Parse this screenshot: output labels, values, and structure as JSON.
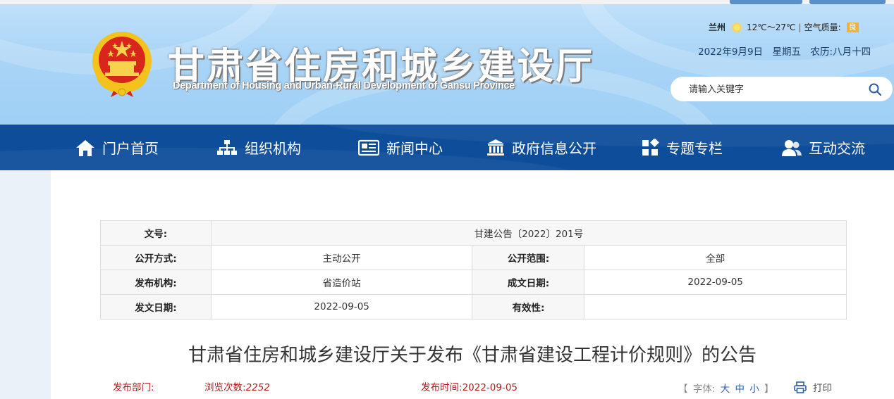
{
  "header": {
    "title": "甘肃省住房和城乡建设厅",
    "subtitle": "Department of Housing and Urban-Rural Development of Gansu Province",
    "weather": {
      "city": "兰州",
      "temp": "12℃～27℃",
      "sep": "|",
      "aqi_label": "空气质量:",
      "aqi_value": "良"
    },
    "date": "2022年9月9日　星期五　农历:八月十四",
    "search_placeholder": "请输入关键字"
  },
  "nav": [
    {
      "label": "门户首页",
      "icon": "home-icon"
    },
    {
      "label": "组织机构",
      "icon": "org-chart-icon"
    },
    {
      "label": "新闻中心",
      "icon": "newspaper-icon"
    },
    {
      "label": "政府信息公开",
      "icon": "government-building-icon"
    },
    {
      "label": "专题专栏",
      "icon": "grid-icon"
    },
    {
      "label": "互动交流",
      "icon": "users-icon"
    }
  ],
  "meta": {
    "doc_no_label": "文号:",
    "doc_no": "甘建公告〔2022〕201号",
    "open_mode_label": "公开方式:",
    "open_mode": "主动公开",
    "open_scope_label": "公开范围:",
    "open_scope": "全部",
    "issuer_label": "发布机构:",
    "issuer": "省造价站",
    "created_label": "成文日期:",
    "created": "2022-09-05",
    "issued_label": "发文日期:",
    "issued": "2022-09-05",
    "validity_label": "有效性:",
    "validity": ""
  },
  "article": {
    "title": "甘肃省住房和城乡建设厅关于发布《甘肃省建设工程计价规则》的公告",
    "dept_label": "发布部门:",
    "views_label": "浏览次数:",
    "views": "2252",
    "time_label": "发布时间:",
    "time": "2022-09-05",
    "font_prefix": "【 字体:",
    "font_large": "大",
    "font_medium": "中",
    "font_small": "小",
    "font_suffix": "】",
    "print_label": "打印"
  },
  "colors": {
    "nav_bg": "#0d4d9a",
    "accent_red": "#b31c1c",
    "header_sky": "#a9d4f6"
  }
}
